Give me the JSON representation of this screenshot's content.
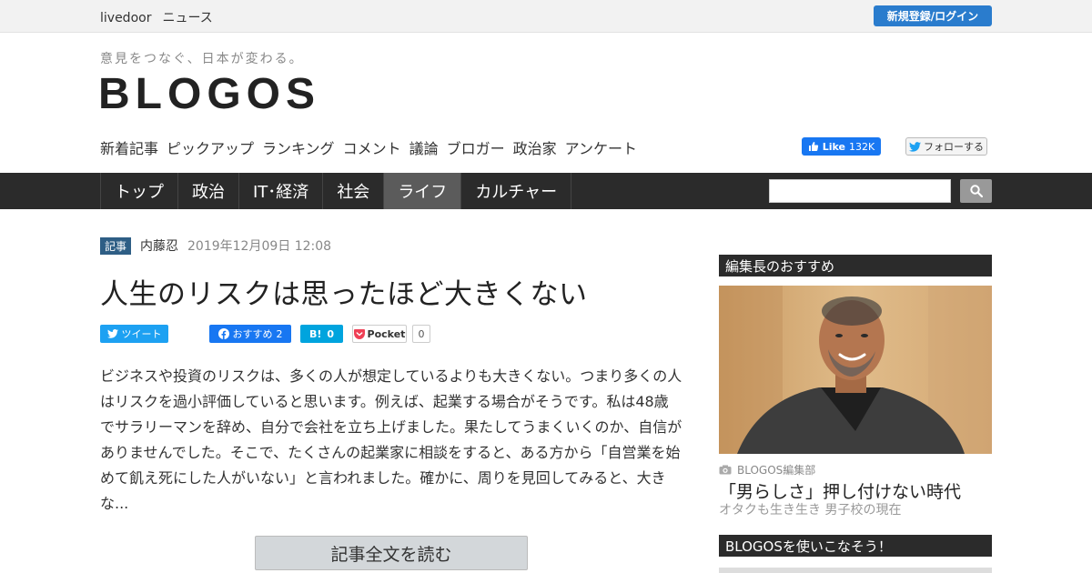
{
  "topbar": {
    "brand_main": "livedoor",
    "brand_sub": "ニュース",
    "login_label": "新規登録/ログイン"
  },
  "header": {
    "tagline": "意見をつなぐ、日本が変わる。",
    "logo": "BLOGOS",
    "subnav": [
      "新着記事",
      "ピックアップ",
      "ランキング",
      "コメント",
      "議論",
      "ブロガー",
      "政治家",
      "アンケート"
    ],
    "fb_like_label": "Like",
    "fb_like_count": "132K",
    "twitter_follow_label": "フォローする"
  },
  "mainnav": {
    "tabs": [
      {
        "label": "トップ",
        "active": false
      },
      {
        "label": "政治",
        "active": false
      },
      {
        "label": "IT･経済",
        "active": false
      },
      {
        "label": "社会",
        "active": false
      },
      {
        "label": "ライフ",
        "active": true
      },
      {
        "label": "カルチャー",
        "active": false
      }
    ],
    "search_placeholder": ""
  },
  "article": {
    "badge": "記事",
    "author": "内藤忍",
    "date": "2019年12月09日 12:08",
    "title": "人生のリスクは思ったほど大きくない",
    "share": {
      "tweet_label": "ツイート",
      "fb_label": "おすすめ",
      "fb_count": "2",
      "hatena_label": "B!",
      "hatena_count": "0",
      "pocket_label": "Pocket",
      "pocket_count": "0"
    },
    "body_lines": [
      "ビジネスや投資のリスクは、多くの人が想定しているよりも大きくない。つまり多くの人",
      "はリスクを過小評価していると思います。例えば、起業する場合がそうです。私は48歳",
      "でサラリーマンを辞め、自分で会社を立ち上げました。果たしてうまくいくのか、自信が",
      "ありませんでした。そこで、たくさんの起業家に相談をすると、ある方から「自営業を始",
      "めて飢え死にした人がいない」と言われました。確かに、周りを見回してみると、大き",
      "な..."
    ],
    "read_more_label": "記事全文を読む"
  },
  "sidebar": {
    "section1_title": "編集長のおすすめ",
    "feature": {
      "author": "BLOGOS編集部",
      "title": "「男らしさ」押し付けない時代",
      "subtitle": "オタクも生き生き 男子校の現在"
    },
    "section2_title": "BLOGOSを使いこなそう！"
  },
  "colors": {
    "nav_bg": "#2b2b2b",
    "nav_active": "#5b5b5b",
    "login_btn": "#2a7ccd",
    "badge": "#2e5e85",
    "twitter": "#1da1f2",
    "facebook": "#1877f2",
    "hatena": "#00a4de"
  },
  "icons": {
    "search": "search-icon",
    "twitter": "twitter-bird-icon",
    "facebook": "facebook-icon",
    "thumbs_up": "thumbs-up-icon",
    "pocket": "pocket-icon",
    "camera": "camera-icon"
  }
}
